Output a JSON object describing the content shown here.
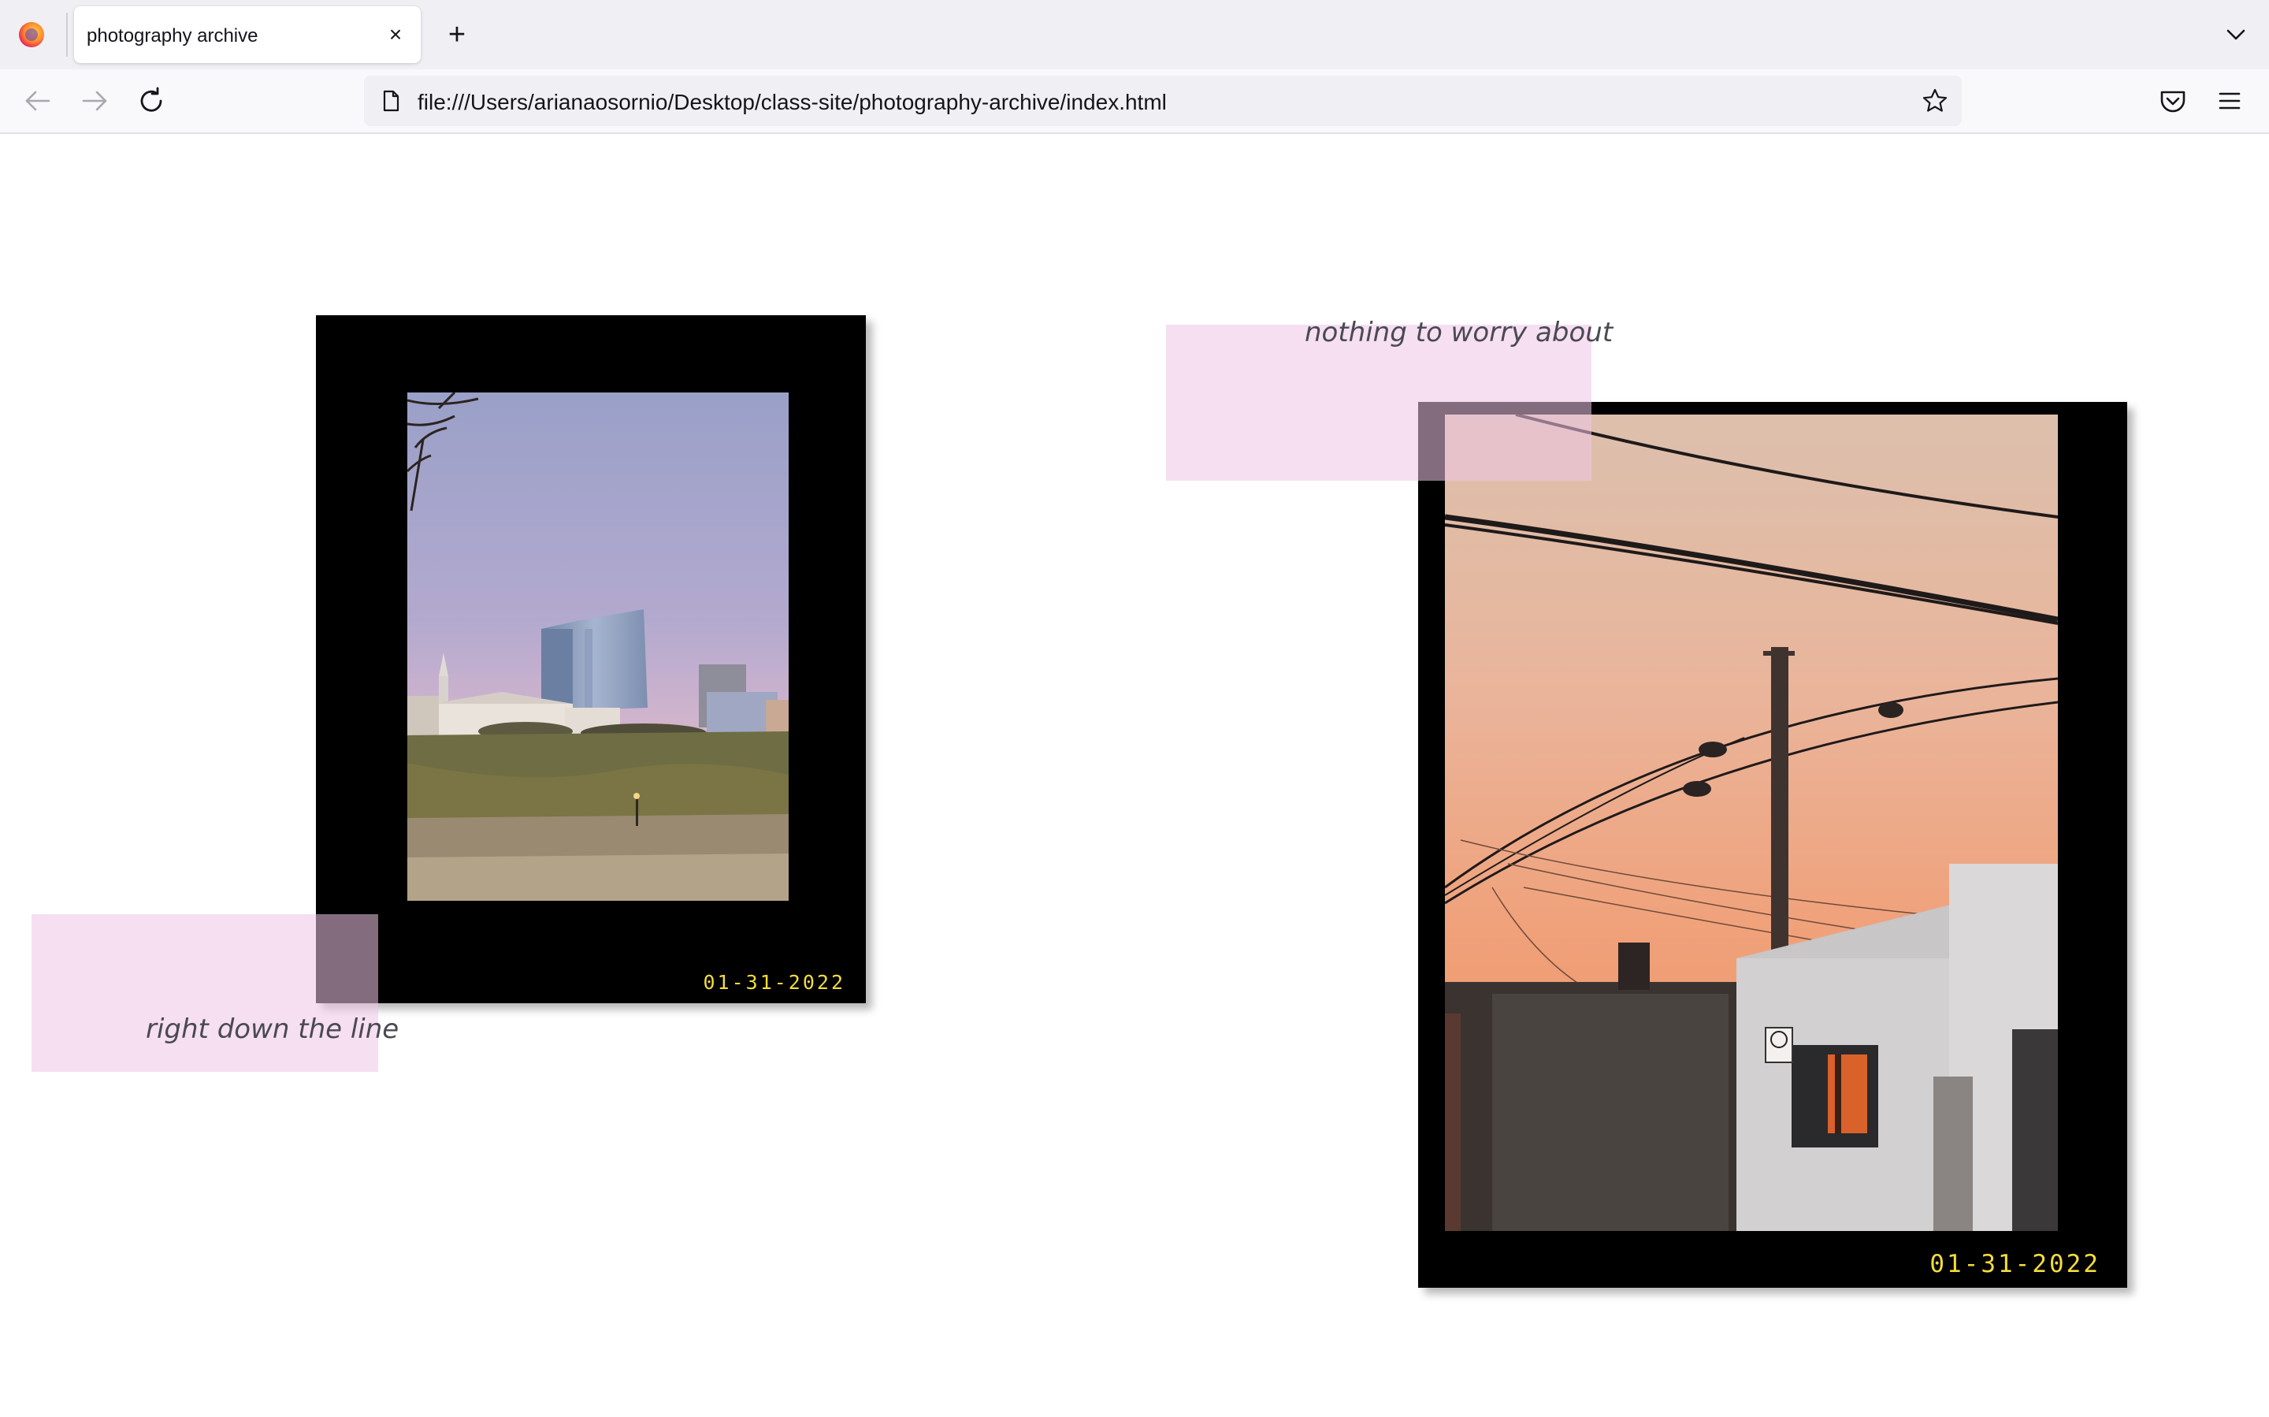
{
  "browser": {
    "tab_title": "photography archive",
    "tab_close_label": "×",
    "new_tab_label": "+",
    "url": "file:///Users/arianaosornio/Desktop/class-site/photography-archive/index.html",
    "icons": [
      "firefox-logo",
      "back-arrow-icon",
      "forward-arrow-icon",
      "reload-icon",
      "page-icon",
      "star-icon",
      "pocket-icon",
      "menu-icon",
      "tab-list-chevron-icon"
    ]
  },
  "photos": [
    {
      "caption": "right down the line",
      "date": "01-31-2022",
      "subject": "city skyline at dusk"
    },
    {
      "caption": "nothing to worry about",
      "date": "01-31-2022",
      "subject": "power lines at sunset"
    }
  ],
  "colors": {
    "frame": "#000000",
    "date": "#f2dc3c",
    "note": "#eec4e6",
    "caption": "#4a4a52"
  }
}
